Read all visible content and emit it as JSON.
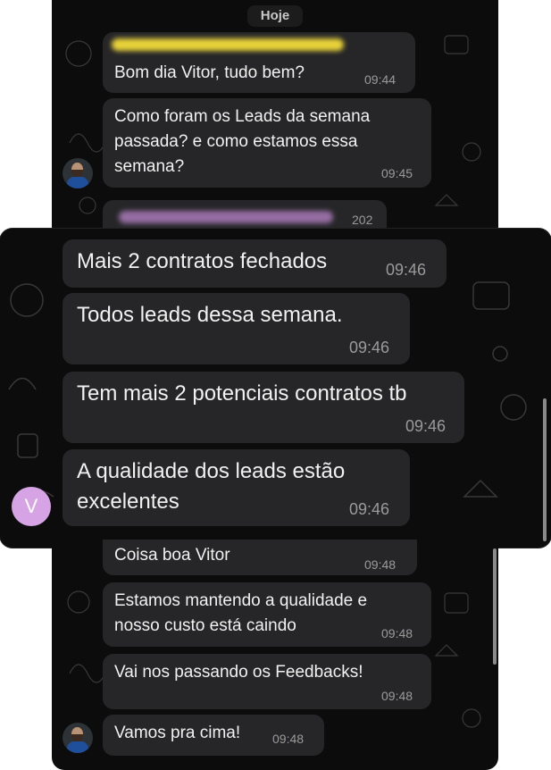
{
  "chat": {
    "date_label": "Hoje",
    "avatar_letter": "V",
    "messages": [
      {
        "text": "Bom dia Vitor, tudo bem?",
        "time": "09:44"
      },
      {
        "text": "Como foram os Leads da semana\npassada? e como estamos essa\nsemana?",
        "time": "09:45"
      },
      {
        "text": "Mais 2 contratos fechados",
        "time": "09:46"
      },
      {
        "text": "Todos leads dessa semana.",
        "time": "09:46"
      },
      {
        "text": "Tem mais 2 potenciais contratos tb",
        "time": "09:46"
      },
      {
        "text": "A qualidade dos leads estão\nexcelentes",
        "time": "09:46"
      },
      {
        "text": "Coisa boa Vitor",
        "time": "09:48"
      },
      {
        "text": "Estamos mantendo a qualidade e\nnosso custo está caindo",
        "time": "09:48"
      },
      {
        "text": "Vai nos passando os Feedbacks!",
        "time": "09:48"
      },
      {
        "text": "Vamos pra cima!",
        "time": "09:48"
      }
    ],
    "partial_time": "202"
  },
  "colors": {
    "background": "#0c0c0c",
    "bubble": "#262628",
    "text": "#f1f1f1",
    "time": "#9a9a9a",
    "sender_name_blur": "#e8d23a",
    "quoted_blur": "#c58cd8",
    "avatar_letter_bg": "#d6a4e4"
  }
}
